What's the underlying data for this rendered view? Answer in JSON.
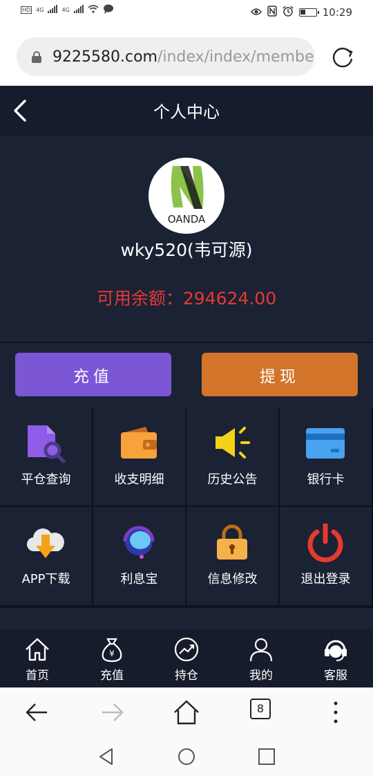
{
  "status": {
    "left": [
      "HD",
      "4G",
      "4G"
    ],
    "time": "10:29"
  },
  "browser": {
    "url_domain": "9225580.com",
    "url_path": "/index/index/membe",
    "tab_count": "8"
  },
  "header": {
    "title": "个人中心"
  },
  "profile": {
    "username": "wky520(韦可源)",
    "balance_label": "可用余额：",
    "balance_value": "294624.00",
    "avatar_text": "OANDA"
  },
  "actions": {
    "recharge_label": "充值",
    "withdraw_label": "提现"
  },
  "grid": [
    {
      "label": "平仓查询",
      "icon": "search-doc-icon"
    },
    {
      "label": "收支明细",
      "icon": "wallet-icon"
    },
    {
      "label": "历史公告",
      "icon": "megaphone-icon"
    },
    {
      "label": "银行卡",
      "icon": "bank-card-icon"
    },
    {
      "label": "APP下载",
      "icon": "cloud-download-icon"
    },
    {
      "label": "利息宝",
      "icon": "headset-icon"
    },
    {
      "label": "信息修改",
      "icon": "lock-icon"
    },
    {
      "label": "退出登录",
      "icon": "power-icon"
    }
  ],
  "nav": [
    {
      "label": "首页",
      "icon": "home-icon"
    },
    {
      "label": "充值",
      "icon": "money-bag-icon"
    },
    {
      "label": "持仓",
      "icon": "trend-icon"
    },
    {
      "label": "我的",
      "icon": "user-icon"
    },
    {
      "label": "客服",
      "icon": "customer-service-icon"
    }
  ],
  "colors": {
    "app_bg": "#1b2234",
    "header_bg": "#161c2b",
    "recharge": "#7b57d6",
    "withdraw": "#d2742a",
    "balance": "#e53935"
  }
}
